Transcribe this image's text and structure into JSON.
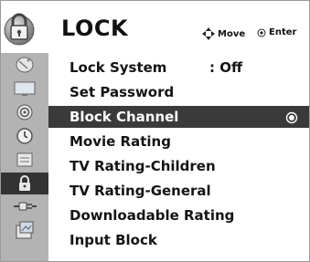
{
  "header": {
    "title": "LOCK",
    "icon": "lock-icon",
    "hints": {
      "move_label": "Move",
      "enter_label": "Enter"
    }
  },
  "sidebar": {
    "items": [
      {
        "icon": "satellite-dish-icon"
      },
      {
        "icon": "tv-screen-icon"
      },
      {
        "icon": "speaker-icon"
      },
      {
        "icon": "clock-icon"
      },
      {
        "icon": "option-box-icon"
      },
      {
        "icon": "lock-icon",
        "active": true
      },
      {
        "icon": "input-plug-icon"
      },
      {
        "icon": "usb-photo-icon"
      }
    ]
  },
  "menu": {
    "items": [
      {
        "label": "Lock System",
        "value": ": Off"
      },
      {
        "label": "Set Password"
      },
      {
        "label": "Block Channel",
        "selected": true
      },
      {
        "label": "Movie Rating"
      },
      {
        "label": "TV Rating-Children"
      },
      {
        "label": "TV Rating-General"
      },
      {
        "label": "Downloadable Rating"
      },
      {
        "label": "Input Block"
      }
    ]
  },
  "colors": {
    "sidebar_bg": "#b3b3b3",
    "selected_bg": "#3a3a3a",
    "active_icon_bg": "#333333",
    "text": "#141414"
  }
}
